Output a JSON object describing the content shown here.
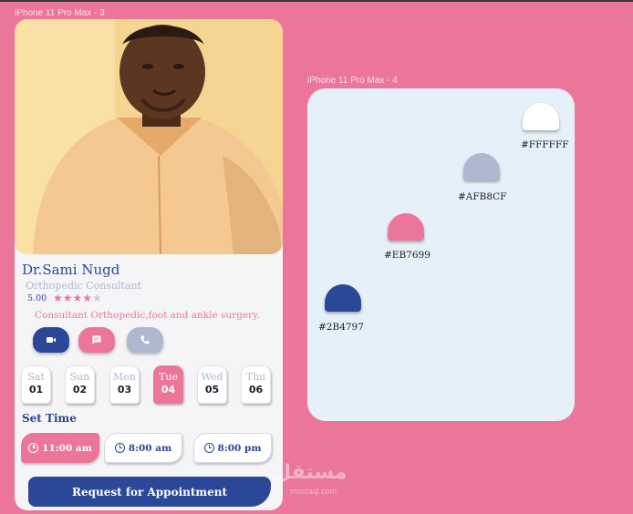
{
  "frames": {
    "profile_label": "iPhone 11 Pro Max - 3",
    "palette_label": "iPhone 11 Pro Max - 4"
  },
  "doctor": {
    "name": "Dr.Sami Nugd",
    "specialty": "Orthopedic Consultant",
    "rating_text": "5.00",
    "rating": 4,
    "rating_max": 5,
    "description": "Consultant Orthopedic,foot and ankle surgery."
  },
  "actions": [
    {
      "icon": "video-call-icon",
      "color": "#2B4797"
    },
    {
      "icon": "chat-icon",
      "color": "#EB7699"
    },
    {
      "icon": "phone-icon",
      "color": "#AFB8CF"
    }
  ],
  "days": [
    {
      "name": "Sat",
      "num": "01",
      "active": false
    },
    {
      "name": "Sun",
      "num": "02",
      "active": false
    },
    {
      "name": "Mon",
      "num": "03",
      "active": false
    },
    {
      "name": "Tue",
      "num": "04",
      "active": true
    },
    {
      "name": "Wed",
      "num": "05",
      "active": false
    },
    {
      "name": "Thu",
      "num": "06",
      "active": false
    }
  ],
  "set_time_label": "Set Time",
  "times": [
    {
      "label": "11:00 am",
      "active": true
    },
    {
      "label": "8:00 am",
      "active": false
    },
    {
      "label": "8:00 pm",
      "active": false
    }
  ],
  "request_button": "Request for Appointment",
  "palette": [
    {
      "hex": "#FFFFFF"
    },
    {
      "hex": "#AFB8CF"
    },
    {
      "hex": "#EB7699"
    },
    {
      "hex": "#2B4797"
    }
  ],
  "watermark": {
    "arabic": "مستقل",
    "latin": "mostaql.com"
  },
  "colors": {
    "background": "#EB7699",
    "primary": "#2B4797",
    "muted": "#AFB8CF",
    "accent": "#EB7699",
    "palette_bg": "#e6f0f8"
  }
}
